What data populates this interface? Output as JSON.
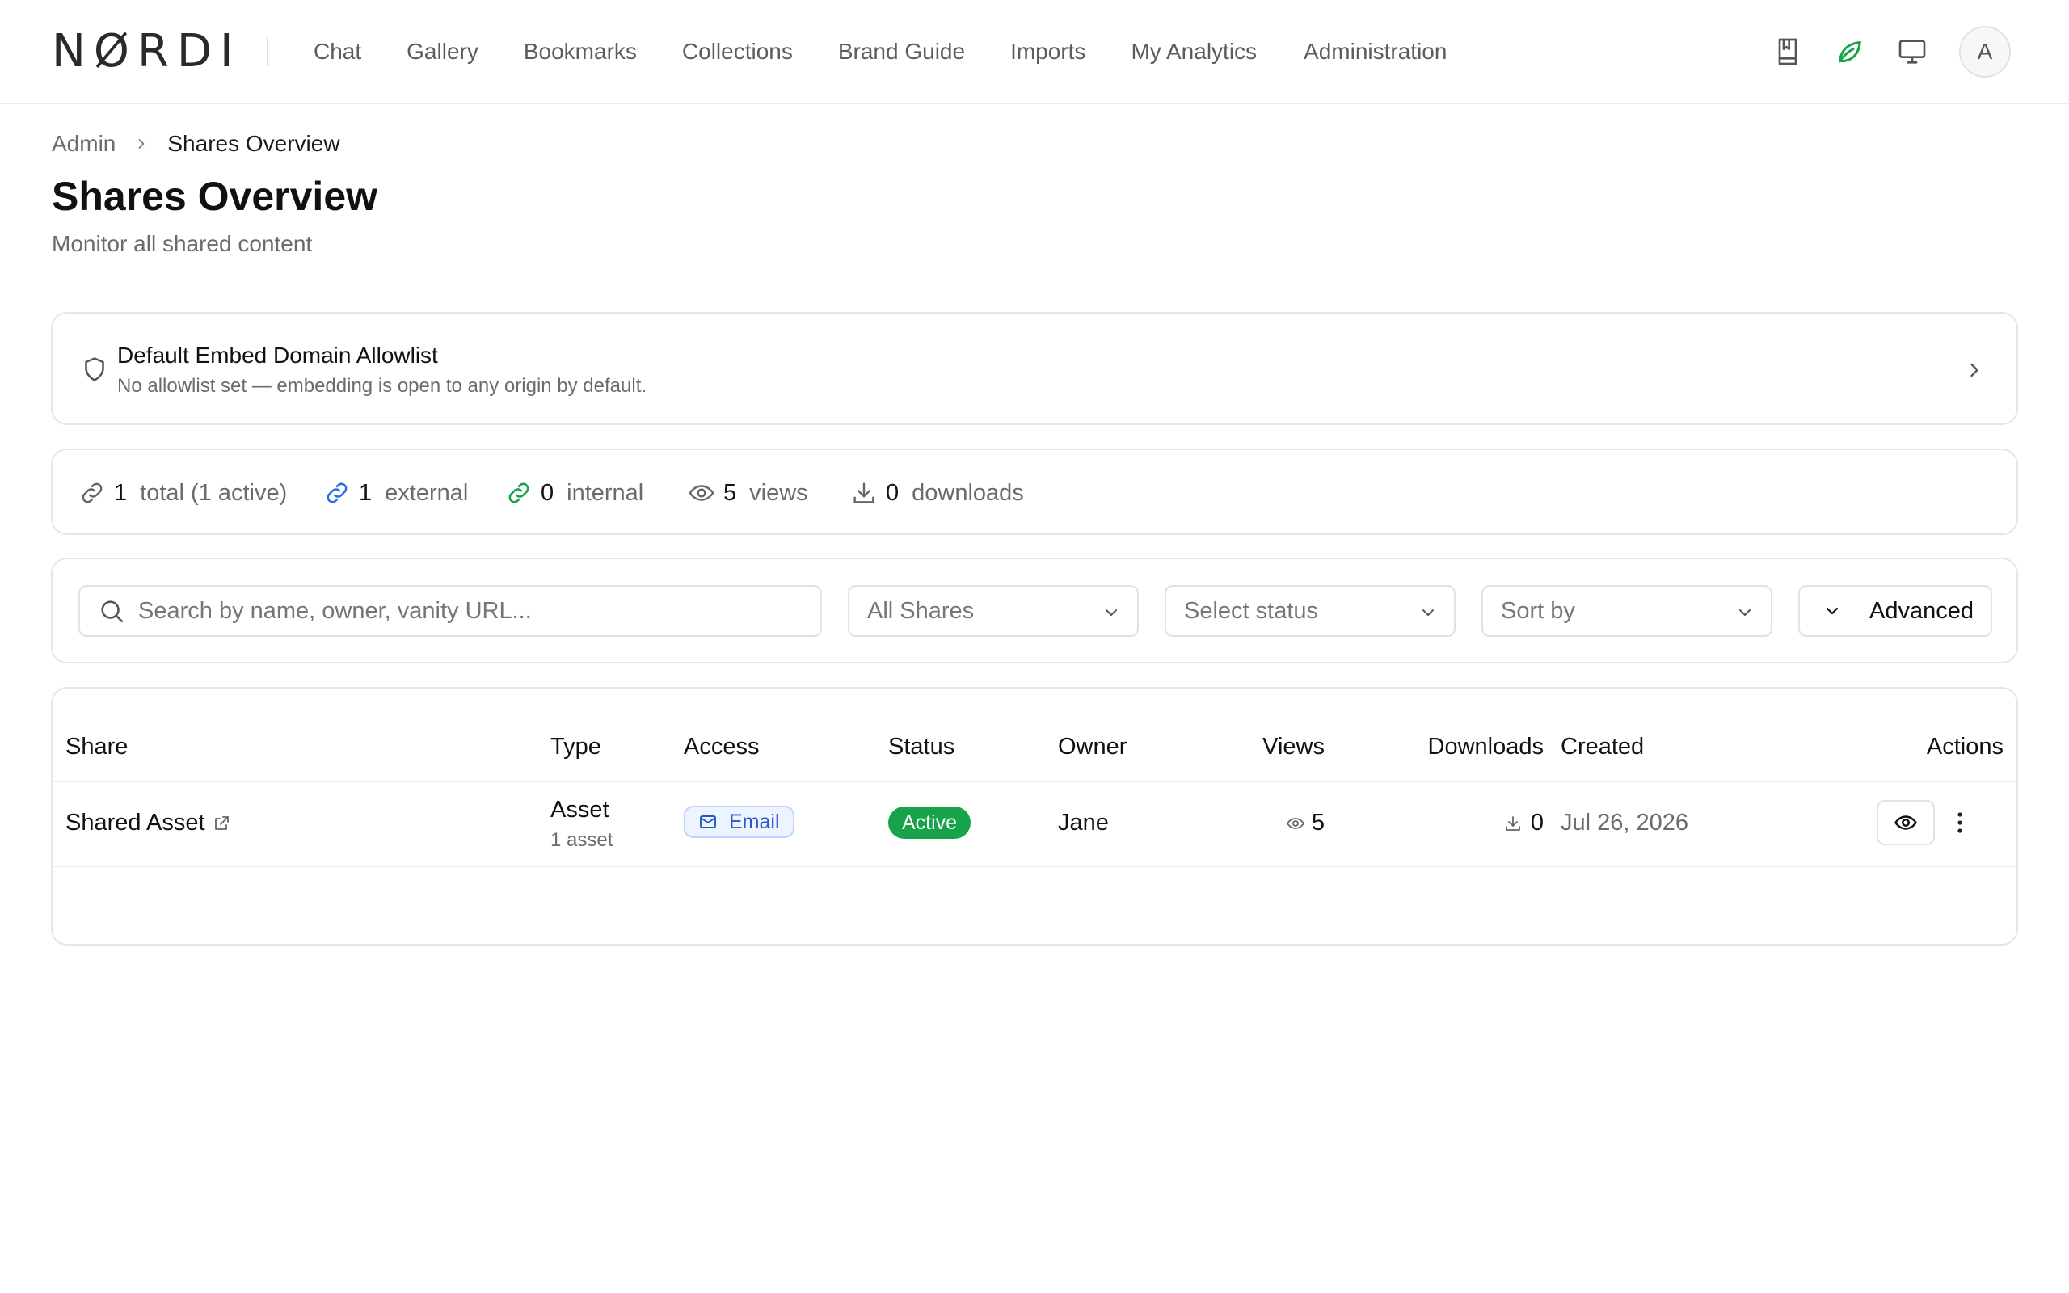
{
  "app": {
    "logo_text": "NØRDI",
    "nav": [
      "Chat",
      "Gallery",
      "Bookmarks",
      "Collections",
      "Brand Guide",
      "Imports",
      "My Analytics",
      "Administration"
    ],
    "avatar_initial": "A",
    "top_icons": [
      "bookmark-book-icon",
      "leaf-icon",
      "monitor-icon"
    ]
  },
  "breadcrumb": {
    "parent": "Admin",
    "current": "Shares Overview"
  },
  "page": {
    "title": "Shares Overview",
    "subtitle": "Monitor all shared content"
  },
  "allowlist": {
    "title": "Default Embed Domain Allowlist",
    "description": "No allowlist set — embedding is open to any origin by default."
  },
  "stats": {
    "total": "1",
    "total_label": "total (1 active)",
    "external": "1",
    "external_label": "external",
    "internal": "0",
    "internal_label": "internal",
    "views": "5",
    "views_label": "views",
    "downloads": "0",
    "downloads_label": "downloads"
  },
  "filters": {
    "search_placeholder": "Search by name, owner, vanity URL...",
    "share_type": "All Shares",
    "status": "Select status",
    "sort": "Sort by",
    "advanced": "Advanced"
  },
  "table": {
    "headers": [
      "Share",
      "Type",
      "Access",
      "Status",
      "Owner",
      "Views",
      "Downloads",
      "Created",
      "Actions"
    ],
    "rows": [
      {
        "share": "Shared Asset",
        "type": "Asset",
        "type_sub": "1 asset",
        "access": "Email",
        "status": "Active",
        "owner": "Jane",
        "views": "5",
        "downloads": "0",
        "created": "Jul 26, 2026"
      }
    ]
  },
  "colors": {
    "active": "#17a34a",
    "email_badge": "#2257c9",
    "external_link": "#2b6fe0",
    "internal_link": "#1aa24a"
  }
}
